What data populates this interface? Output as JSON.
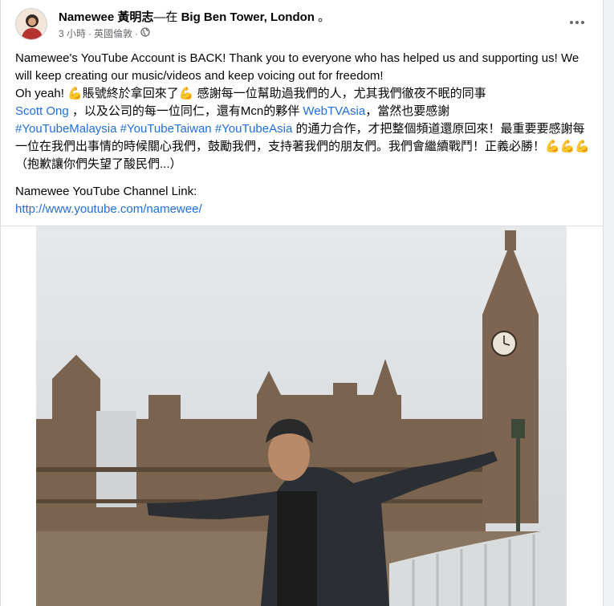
{
  "post": {
    "author": "Namewee 黃明志",
    "location_prefix": "—在",
    "location": "Big Ben Tower, London",
    "location_suffix": "。",
    "time": "3 小時",
    "dot": "·",
    "place": "英國倫敦",
    "dot2": "·",
    "privacy_icon": "globe-icon",
    "more_icon": "more-options-icon"
  },
  "content": {
    "line1": "Namewee's YouTube Account is BACK! Thank you to everyone who has helped us and supporting us! We will keep creating our music/videos and keep voicing out for freedom!",
    "line2a": "Oh yeah! ",
    "line2b": "賬號終於拿回來了",
    "line2c": " 感謝每一位幫助過我們的人，尤其我們徹夜不眠的同事",
    "mention1": "Scott Ong",
    "line3a": " ，以及公司的每一位同仁，還有Mcn的夥伴 ",
    "mention2": "WebTVAsia",
    "line3b": "，當然也要感謝",
    "tag1": "#YouTubeMalaysia",
    "tag2": "#YouTubeTaiwan",
    "tag3": "#YouTubeAsia",
    "line4": " 的通力合作，才把整個頻道還原回來！最重要要感謝每一位在我們出事情的時候關心我們，鼓勵我們，支持著我們的朋友們。我們會繼續戰鬥！正義必勝！",
    "line5": "（抱歉讓你們失望了酸民們...）",
    "link_label": "Namewee YouTube Channel Link:",
    "link_url": "http://www.youtube.com/namewee/"
  },
  "colors": {
    "link": "#216fdb",
    "meta": "#65676b",
    "background": "#f0f2f5"
  }
}
